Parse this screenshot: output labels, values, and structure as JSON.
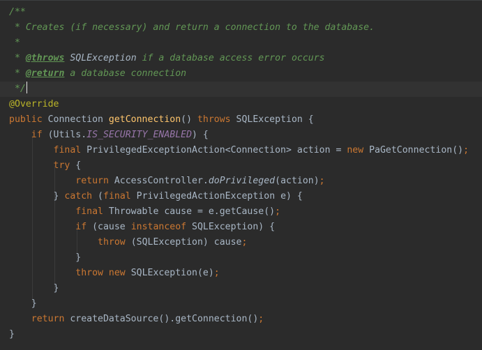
{
  "editor": {
    "language": "java",
    "current_line_index": 5,
    "lines": [
      [
        {
          "t": "/**",
          "c": "doc"
        }
      ],
      [
        {
          "t": " * Creates (if necessary) and return a connection to the database.",
          "c": "doc"
        }
      ],
      [
        {
          "t": " *",
          "c": "doc"
        }
      ],
      [
        {
          "t": " * ",
          "c": "doc"
        },
        {
          "t": "@throws",
          "c": "doctag"
        },
        {
          "t": " ",
          "c": "doc"
        },
        {
          "t": "SQLException",
          "c": "docref"
        },
        {
          "t": " if a database access error occurs",
          "c": "doc"
        }
      ],
      [
        {
          "t": " * ",
          "c": "doc"
        },
        {
          "t": "@return",
          "c": "doctag"
        },
        {
          "t": " a database connection",
          "c": "doc"
        }
      ],
      [
        {
          "t": " */",
          "c": "doc"
        }
      ],
      [
        {
          "t": "@Override",
          "c": "anno"
        }
      ],
      [
        {
          "t": "public ",
          "c": "kw"
        },
        {
          "t": "Connection ",
          "c": "text"
        },
        {
          "t": "getConnection",
          "c": "fn"
        },
        {
          "t": "() ",
          "c": "text"
        },
        {
          "t": "throws ",
          "c": "kw"
        },
        {
          "t": "SQLException {",
          "c": "text"
        }
      ],
      [
        {
          "t": "    ",
          "c": "text"
        },
        {
          "t": "if ",
          "c": "kw"
        },
        {
          "t": "(Utils.",
          "c": "text"
        },
        {
          "t": "IS_SECURITY_ENABLED",
          "c": "static"
        },
        {
          "t": ") {",
          "c": "text"
        }
      ],
      [
        {
          "t": "        ",
          "c": "text"
        },
        {
          "t": "final ",
          "c": "kw"
        },
        {
          "t": "PrivilegedExceptionAction<Connection> action = ",
          "c": "text"
        },
        {
          "t": "new ",
          "c": "kw"
        },
        {
          "t": "PaGetConnection()",
          "c": "text"
        },
        {
          "t": ";",
          "c": "kw"
        }
      ],
      [
        {
          "t": "        ",
          "c": "text"
        },
        {
          "t": "try ",
          "c": "kw"
        },
        {
          "t": "{",
          "c": "text"
        }
      ],
      [
        {
          "t": "            ",
          "c": "text"
        },
        {
          "t": "return ",
          "c": "kw"
        },
        {
          "t": "AccessController.",
          "c": "text"
        },
        {
          "t": "doPrivileged",
          "c": "callstatic"
        },
        {
          "t": "(action)",
          "c": "text"
        },
        {
          "t": ";",
          "c": "kw"
        }
      ],
      [
        {
          "t": "        } ",
          "c": "text"
        },
        {
          "t": "catch ",
          "c": "kw"
        },
        {
          "t": "(",
          "c": "text"
        },
        {
          "t": "final ",
          "c": "kw"
        },
        {
          "t": "PrivilegedActionException e) {",
          "c": "text"
        }
      ],
      [
        {
          "t": "            ",
          "c": "text"
        },
        {
          "t": "final ",
          "c": "kw"
        },
        {
          "t": "Throwable cause = e.getCause()",
          "c": "text"
        },
        {
          "t": ";",
          "c": "kw"
        }
      ],
      [
        {
          "t": "            ",
          "c": "text"
        },
        {
          "t": "if ",
          "c": "kw"
        },
        {
          "t": "(cause ",
          "c": "text"
        },
        {
          "t": "instanceof ",
          "c": "kw"
        },
        {
          "t": "SQLException) {",
          "c": "text"
        }
      ],
      [
        {
          "t": "                ",
          "c": "text"
        },
        {
          "t": "throw ",
          "c": "kw"
        },
        {
          "t": "(SQLException) cause",
          "c": "text"
        },
        {
          "t": ";",
          "c": "kw"
        }
      ],
      [
        {
          "t": "            }",
          "c": "text"
        }
      ],
      [
        {
          "t": "            ",
          "c": "text"
        },
        {
          "t": "throw ",
          "c": "kw"
        },
        {
          "t": "new ",
          "c": "kw"
        },
        {
          "t": "SQLException(e)",
          "c": "text"
        },
        {
          "t": ";",
          "c": "kw"
        }
      ],
      [
        {
          "t": "        }",
          "c": "text"
        }
      ],
      [
        {
          "t": "    }",
          "c": "text"
        }
      ],
      [
        {
          "t": "    ",
          "c": "text"
        },
        {
          "t": "return ",
          "c": "kw"
        },
        {
          "t": "createDataSource().getConnection()",
          "c": "text"
        },
        {
          "t": ";",
          "c": "kw"
        }
      ],
      [
        {
          "t": "}",
          "c": "text"
        }
      ]
    ]
  }
}
